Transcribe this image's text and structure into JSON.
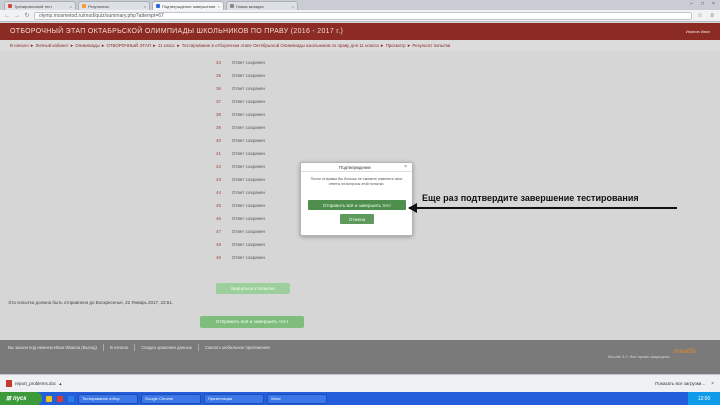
{
  "browser": {
    "tabs": [
      {
        "label": "Тренировочный тест",
        "active": false,
        "fav_color": "#d6463a"
      },
      {
        "label": "Результаты",
        "active": false,
        "fav_color": "#f0a030"
      },
      {
        "label": "Подтверждение завершения",
        "active": true,
        "fav_color": "#2b6ad6"
      },
      {
        "label": "Новая вкладка",
        "active": false,
        "fav_color": "#888888"
      }
    ],
    "url": "olymp.mosmetod.ru/mod/quiz/summary.php?attempt=67",
    "window_controls": [
      "–",
      "□",
      "×"
    ]
  },
  "header": {
    "title": "ОТБОРОЧНЫЙ ЭТАП ОКТАБРЬСКОЙ ОЛИМПИАДЫ ШКОЛЬНИКОВ ПО ПРАВУ (2016 - 2017 г.)",
    "user": "Иванов Иван"
  },
  "breadcrumb": "В начало ► Личный кабинет ► Олимпиады ► ОТБОРОЧНЫЙ ЭТАП ► 11 класс ► Тестирование в отборочном этапе Октябрьской Олимпиады школьников по праву для 11 класса ► Просмотр ► Результат попытки",
  "questions": [
    {
      "num": "34",
      "status": "Ответ сохранен"
    },
    {
      "num": "35",
      "status": "Ответ сохранен"
    },
    {
      "num": "36",
      "status": "Ответ сохранен"
    },
    {
      "num": "37",
      "status": "Ответ сохранен"
    },
    {
      "num": "38",
      "status": "Ответ сохранен"
    },
    {
      "num": "39",
      "status": "Ответ сохранен"
    },
    {
      "num": "40",
      "status": "Ответ сохранен"
    },
    {
      "num": "41",
      "status": "Ответ сохранен"
    },
    {
      "num": "42",
      "status": "Ответ сохранен"
    },
    {
      "num": "43",
      "status": "Ответ сохранен"
    },
    {
      "num": "44",
      "status": "Ответ сохранен"
    },
    {
      "num": "45",
      "status": "Ответ сохранен"
    },
    {
      "num": "46",
      "status": "Ответ сохранен"
    },
    {
      "num": "47",
      "status": "Ответ сохранен"
    },
    {
      "num": "48",
      "status": "Ответ сохранен"
    },
    {
      "num": "49",
      "status": "Ответ сохранен"
    }
  ],
  "return_button": "Вернуться к попытке",
  "deadline_text": "Эта попытка должна быть отправлена до Воскресенье, 22 Январь 2017, 23:51.",
  "finish_button": "Отправить всё и завершить тест",
  "footer": {
    "login_info": "Вы зашли под именем Иван Иванов (Выход)",
    "home": "В начало",
    "data_summary": "Сводка хранения данных",
    "mobile_app": "Скачать мобильное приложение",
    "copyright": "Moodle 3.0. Все права защищены",
    "logo": "moodle"
  },
  "dialog": {
    "title": "Подтверждение",
    "body": "После отправки Вы больше не сможете изменить свои ответы на вопросы этой попытки.",
    "confirm": "Отправить всё и завершить тест",
    "cancel": "Отмена"
  },
  "annotation": "Еще раз подтвердите завершение тестирования",
  "download_bar": {
    "file": "report_problems.doc",
    "show_all": "Показать все загрузки..."
  },
  "taskbar": {
    "start": "пуск",
    "tasks": [
      "Тестирование отбор",
      "Google Chrome",
      "Презентация",
      "Word"
    ],
    "clock": "12:00"
  }
}
